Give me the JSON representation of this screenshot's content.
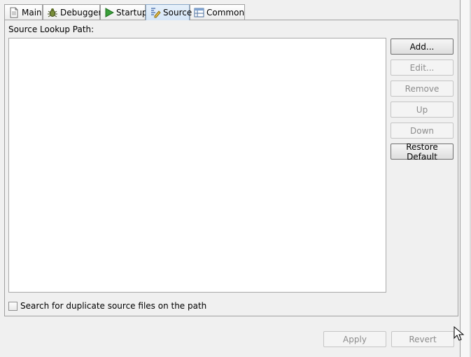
{
  "tabs": [
    {
      "label": "Main",
      "icon": "document-icon",
      "active": false
    },
    {
      "label": "Debugger",
      "icon": "bug-icon",
      "active": false
    },
    {
      "label": "Startup",
      "icon": "play-icon",
      "active": false
    },
    {
      "label": "Source",
      "icon": "source-icon",
      "active": true
    },
    {
      "label": "Common",
      "icon": "table-icon",
      "active": false
    }
  ],
  "source": {
    "lookup_label": "Source Lookup Path:",
    "buttons": {
      "add": "Add...",
      "edit": "Edit...",
      "remove": "Remove",
      "up": "Up",
      "down": "Down",
      "restore": "Restore Default"
    },
    "duplicate_checkbox": {
      "label": "Search for duplicate source files on the path",
      "checked": false
    }
  },
  "footer": {
    "apply": "Apply",
    "revert": "Revert"
  },
  "colors": {
    "accent": "#d5e6f7",
    "border": "#a0a0a0",
    "disabled_text": "#8c8c8c"
  }
}
